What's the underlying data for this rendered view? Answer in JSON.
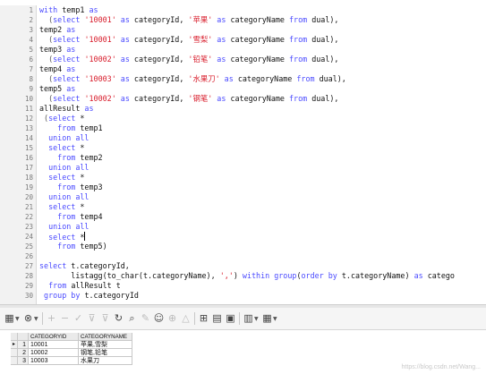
{
  "editor": {
    "lines": [
      {
        "n": "1",
        "tokens": [
          {
            "t": "with ",
            "c": "kw"
          },
          {
            "t": "temp1 ",
            "c": "id"
          },
          {
            "t": "as",
            "c": "kw"
          }
        ]
      },
      {
        "n": "2",
        "tokens": [
          {
            "t": "  (",
            "c": "op"
          },
          {
            "t": "select ",
            "c": "kw"
          },
          {
            "t": "'10001'",
            "c": "str"
          },
          {
            "t": " as ",
            "c": "kw"
          },
          {
            "t": "categoryId, ",
            "c": "id"
          },
          {
            "t": "'苹果'",
            "c": "str"
          },
          {
            "t": " as ",
            "c": "kw"
          },
          {
            "t": "categoryName ",
            "c": "id"
          },
          {
            "t": "from ",
            "c": "kw"
          },
          {
            "t": "dual),",
            "c": "id"
          }
        ]
      },
      {
        "n": "3",
        "tokens": [
          {
            "t": "temp2 ",
            "c": "id"
          },
          {
            "t": "as",
            "c": "kw"
          }
        ]
      },
      {
        "n": "4",
        "tokens": [
          {
            "t": "  (",
            "c": "op"
          },
          {
            "t": "select ",
            "c": "kw"
          },
          {
            "t": "'10001'",
            "c": "str"
          },
          {
            "t": " as ",
            "c": "kw"
          },
          {
            "t": "categoryId, ",
            "c": "id"
          },
          {
            "t": "'雪梨'",
            "c": "str"
          },
          {
            "t": " as ",
            "c": "kw"
          },
          {
            "t": "categoryName ",
            "c": "id"
          },
          {
            "t": "from ",
            "c": "kw"
          },
          {
            "t": "dual),",
            "c": "id"
          }
        ]
      },
      {
        "n": "5",
        "tokens": [
          {
            "t": "temp3 ",
            "c": "id"
          },
          {
            "t": "as",
            "c": "kw"
          }
        ]
      },
      {
        "n": "6",
        "tokens": [
          {
            "t": "  (",
            "c": "op"
          },
          {
            "t": "select ",
            "c": "kw"
          },
          {
            "t": "'10002'",
            "c": "str"
          },
          {
            "t": " as ",
            "c": "kw"
          },
          {
            "t": "categoryId, ",
            "c": "id"
          },
          {
            "t": "'铅笔'",
            "c": "str"
          },
          {
            "t": " as ",
            "c": "kw"
          },
          {
            "t": "categoryName ",
            "c": "id"
          },
          {
            "t": "from ",
            "c": "kw"
          },
          {
            "t": "dual),",
            "c": "id"
          }
        ]
      },
      {
        "n": "7",
        "tokens": [
          {
            "t": "temp4 ",
            "c": "id"
          },
          {
            "t": "as",
            "c": "kw"
          }
        ]
      },
      {
        "n": "8",
        "tokens": [
          {
            "t": "  (",
            "c": "op"
          },
          {
            "t": "select ",
            "c": "kw"
          },
          {
            "t": "'10003'",
            "c": "str"
          },
          {
            "t": " as ",
            "c": "kw"
          },
          {
            "t": "categoryId, ",
            "c": "id"
          },
          {
            "t": "'水果刀'",
            "c": "str"
          },
          {
            "t": " as ",
            "c": "kw"
          },
          {
            "t": "categoryName ",
            "c": "id"
          },
          {
            "t": "from ",
            "c": "kw"
          },
          {
            "t": "dual),",
            "c": "id"
          }
        ]
      },
      {
        "n": "9",
        "tokens": [
          {
            "t": "temp5 ",
            "c": "id"
          },
          {
            "t": "as",
            "c": "kw"
          }
        ]
      },
      {
        "n": "10",
        "tokens": [
          {
            "t": "  (",
            "c": "op"
          },
          {
            "t": "select ",
            "c": "kw"
          },
          {
            "t": "'10002'",
            "c": "str"
          },
          {
            "t": " as ",
            "c": "kw"
          },
          {
            "t": "categoryId, ",
            "c": "id"
          },
          {
            "t": "'钢笔'",
            "c": "str"
          },
          {
            "t": " as ",
            "c": "kw"
          },
          {
            "t": "categoryName ",
            "c": "id"
          },
          {
            "t": "from ",
            "c": "kw"
          },
          {
            "t": "dual),",
            "c": "id"
          }
        ]
      },
      {
        "n": "11",
        "tokens": [
          {
            "t": "allResult ",
            "c": "id"
          },
          {
            "t": "as",
            "c": "kw"
          }
        ]
      },
      {
        "n": "12",
        "tokens": [
          {
            "t": " (",
            "c": "op"
          },
          {
            "t": "select ",
            "c": "kw"
          },
          {
            "t": "*",
            "c": "id"
          }
        ]
      },
      {
        "n": "13",
        "tokens": [
          {
            "t": "    ",
            "c": "id"
          },
          {
            "t": "from ",
            "c": "kw"
          },
          {
            "t": "temp1",
            "c": "id"
          }
        ]
      },
      {
        "n": "14",
        "tokens": [
          {
            "t": "  ",
            "c": "id"
          },
          {
            "t": "union all",
            "c": "kw"
          }
        ]
      },
      {
        "n": "15",
        "tokens": [
          {
            "t": "  ",
            "c": "id"
          },
          {
            "t": "select ",
            "c": "kw"
          },
          {
            "t": "*",
            "c": "id"
          }
        ]
      },
      {
        "n": "16",
        "tokens": [
          {
            "t": "    ",
            "c": "id"
          },
          {
            "t": "from ",
            "c": "kw"
          },
          {
            "t": "temp2",
            "c": "id"
          }
        ]
      },
      {
        "n": "17",
        "tokens": [
          {
            "t": "  ",
            "c": "id"
          },
          {
            "t": "union all",
            "c": "kw"
          }
        ]
      },
      {
        "n": "18",
        "tokens": [
          {
            "t": "  ",
            "c": "id"
          },
          {
            "t": "select ",
            "c": "kw"
          },
          {
            "t": "*",
            "c": "id"
          }
        ]
      },
      {
        "n": "19",
        "tokens": [
          {
            "t": "    ",
            "c": "id"
          },
          {
            "t": "from ",
            "c": "kw"
          },
          {
            "t": "temp3",
            "c": "id"
          }
        ]
      },
      {
        "n": "20",
        "tokens": [
          {
            "t": "  ",
            "c": "id"
          },
          {
            "t": "union all",
            "c": "kw"
          }
        ]
      },
      {
        "n": "21",
        "tokens": [
          {
            "t": "  ",
            "c": "id"
          },
          {
            "t": "select ",
            "c": "kw"
          },
          {
            "t": "*",
            "c": "id"
          }
        ]
      },
      {
        "n": "22",
        "tokens": [
          {
            "t": "    ",
            "c": "id"
          },
          {
            "t": "from ",
            "c": "kw"
          },
          {
            "t": "temp4",
            "c": "id"
          }
        ]
      },
      {
        "n": "23",
        "tokens": [
          {
            "t": "  ",
            "c": "id"
          },
          {
            "t": "union all",
            "c": "kw"
          }
        ]
      },
      {
        "n": "24",
        "caret": true,
        "tokens": [
          {
            "t": "  ",
            "c": "id"
          },
          {
            "t": "select ",
            "c": "kw"
          },
          {
            "t": "*",
            "c": "id"
          }
        ]
      },
      {
        "n": "25",
        "tokens": [
          {
            "t": "    ",
            "c": "id"
          },
          {
            "t": "from ",
            "c": "kw"
          },
          {
            "t": "temp5)",
            "c": "id"
          }
        ]
      },
      {
        "n": "26",
        "tokens": []
      },
      {
        "n": "27",
        "tokens": [
          {
            "t": "select ",
            "c": "kw"
          },
          {
            "t": "t.categoryId,",
            "c": "id"
          }
        ]
      },
      {
        "n": "28",
        "tokens": [
          {
            "t": "       listagg(to_char(t.categoryName), ",
            "c": "id"
          },
          {
            "t": "','",
            "c": "str"
          },
          {
            "t": ") ",
            "c": "id"
          },
          {
            "t": "within group",
            "c": "kw"
          },
          {
            "t": "(",
            "c": "id"
          },
          {
            "t": "order by ",
            "c": "kw"
          },
          {
            "t": "t.categoryName) ",
            "c": "id"
          },
          {
            "t": "as ",
            "c": "kw"
          },
          {
            "t": "catego",
            "c": "id"
          }
        ]
      },
      {
        "n": "29",
        "tokens": [
          {
            "t": "  ",
            "c": "id"
          },
          {
            "t": "from ",
            "c": "kw"
          },
          {
            "t": "allResult t",
            "c": "id"
          }
        ]
      },
      {
        "n": "30",
        "tokens": [
          {
            "t": " ",
            "c": "id"
          },
          {
            "t": "group by ",
            "c": "kw"
          },
          {
            "t": "t.categoryId",
            "c": "id"
          }
        ]
      }
    ]
  },
  "toolbar": {
    "icons": [
      {
        "name": "grid-view-icon",
        "glyph": "▦",
        "caret": true,
        "dim": false
      },
      {
        "name": "lock-icon",
        "glyph": "⊗",
        "caret": true,
        "dim": false
      },
      {
        "name": "add-record-icon",
        "glyph": "+",
        "dim": true
      },
      {
        "name": "delete-record-icon",
        "glyph": "−",
        "dim": true
      },
      {
        "name": "post-changes-icon",
        "glyph": "✓",
        "dim": true
      },
      {
        "name": "filter-icon",
        "glyph": "⊽",
        "dim": true
      },
      {
        "name": "clear-filter-icon",
        "glyph": "⊽",
        "dim": true
      },
      {
        "name": "refresh-icon",
        "glyph": "↻",
        "dim": false
      },
      {
        "name": "find-icon",
        "glyph": "⌕",
        "dim": false
      },
      {
        "name": "edit-icon",
        "glyph": "✎",
        "dim": true
      },
      {
        "name": "single-record-icon",
        "glyph": "☺",
        "dim": false
      },
      {
        "name": "navigate-icon",
        "glyph": "⊕",
        "dim": true
      },
      {
        "name": "clear-icon",
        "glyph": "△",
        "dim": true
      },
      {
        "name": "query-icon",
        "glyph": "⊞",
        "dim": false
      },
      {
        "name": "export-icon",
        "glyph": "▤",
        "dim": false
      },
      {
        "name": "save-icon",
        "glyph": "▣",
        "dim": false
      },
      {
        "name": "chart-icon",
        "glyph": "▥",
        "caret": true,
        "dim": false
      },
      {
        "name": "print-icon",
        "glyph": "▦",
        "caret": true,
        "dim": false
      }
    ]
  },
  "grid": {
    "columns": [
      "CATEGORYID",
      "CATEGORYNAME"
    ],
    "rows": [
      {
        "n": "1",
        "indicator": "▸",
        "values": [
          "10001",
          "苹果,雪梨"
        ]
      },
      {
        "n": "2",
        "indicator": "",
        "values": [
          "10002",
          "钢笔,铅笔"
        ]
      },
      {
        "n": "3",
        "indicator": "",
        "values": [
          "10003",
          "水果刀"
        ]
      }
    ]
  },
  "watermark": "https://blog.csdn.net/Wang..."
}
